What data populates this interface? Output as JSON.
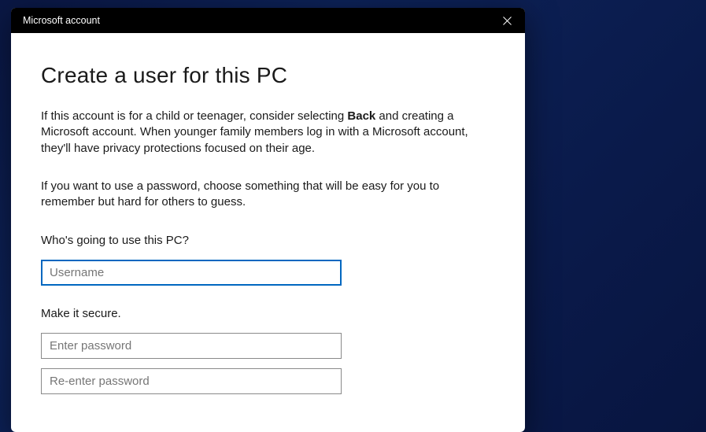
{
  "titlebar": {
    "title": "Microsoft account"
  },
  "main": {
    "heading": "Create a user for this PC",
    "desc1_pre": "If this account is for a child or teenager, consider selecting ",
    "desc1_bold": "Back",
    "desc1_post": " and creating a Microsoft account. When younger family members log in with a Microsoft account, they'll have privacy protections focused on their age.",
    "desc2": "If you want to use a password, choose something that will be easy for you to remember but hard for others to guess.",
    "who_label": "Who's going to use this PC?",
    "username_placeholder": "Username",
    "username_value": "",
    "secure_label": "Make it secure.",
    "password_placeholder": "Enter password",
    "password_value": "",
    "reenter_placeholder": "Re-enter password",
    "reenter_value": ""
  }
}
